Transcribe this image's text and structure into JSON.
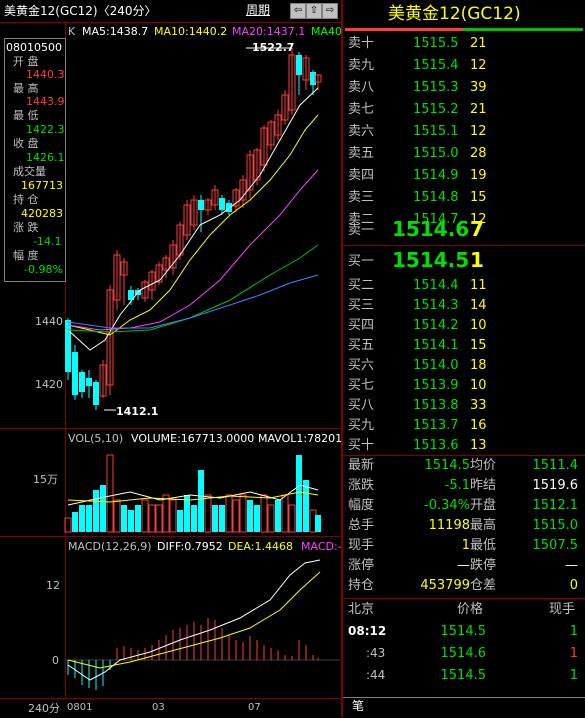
{
  "window": {
    "title": "美黄金12(GC12)〈240分〉",
    "period_button": "周期",
    "nav_buttons": [
      "⇦",
      "⇧",
      "⇨",
      "⇩"
    ]
  },
  "info_panel": {
    "time": "08010500",
    "open_label": "开 盘",
    "open": "1440.3",
    "high_label": "最 高",
    "high": "1443.9",
    "low_label": "最 低",
    "low": "1422.3",
    "close_label": "收 盘",
    "close": "1426.1",
    "volume_label": "成交量",
    "volume": "167713",
    "oi_label": "持 仓",
    "oi": "420283",
    "change_label": "涨 跌",
    "change": "-14.1",
    "pct_label": "幅 度",
    "pct": "-0.98%"
  },
  "main_chart": {
    "k_label": "K",
    "ma5": "MA5:1438.7",
    "ma10": "MA10:1440.2",
    "ma20": "MA20:1437.1",
    "ma40": "MA40",
    "high_annotation": "1522.7",
    "low_annotation": "1412.1",
    "y_ticks": [
      "1440",
      "1420"
    ]
  },
  "volume_chart": {
    "label": "VOL(5,10)",
    "volume": "VOLUME:167713.0000",
    "mavol": "MAVOL1:78201",
    "y_tick": "15万"
  },
  "macd_chart": {
    "label": "MACD(12,26,9)",
    "diff": "DIFF:0.7952",
    "dea": "DEA:1.4468",
    "macd": "MACD:-",
    "y_ticks": [
      "12",
      "0"
    ]
  },
  "bottom_bar": {
    "period": "240分",
    "x_ticks": [
      "0801",
      "03",
      "07"
    ]
  },
  "quote": {
    "title": "美黄金12(GC12)",
    "colors": {
      "up": "#ff3c3c",
      "down": "#00e000",
      "neutral": "#ffff00"
    },
    "sells": [
      {
        "label": "卖十",
        "price": "1515.5",
        "qty": "21"
      },
      {
        "label": "卖九",
        "price": "1515.4",
        "qty": "12"
      },
      {
        "label": "卖八",
        "price": "1515.3",
        "qty": "39"
      },
      {
        "label": "卖七",
        "price": "1515.2",
        "qty": "21"
      },
      {
        "label": "卖六",
        "price": "1515.1",
        "qty": "12"
      },
      {
        "label": "卖五",
        "price": "1515.0",
        "qty": "28"
      },
      {
        "label": "卖四",
        "price": "1514.9",
        "qty": "19"
      },
      {
        "label": "卖三",
        "price": "1514.8",
        "qty": "15"
      },
      {
        "label": "卖二",
        "price": "1514.7",
        "qty": "12"
      }
    ],
    "sell1": {
      "label": "卖一",
      "price": "1514.6",
      "qty": "7"
    },
    "buy1": {
      "label": "买一",
      "price": "1514.5",
      "qty": "1"
    },
    "buys": [
      {
        "label": "买二",
        "price": "1514.4",
        "qty": "11"
      },
      {
        "label": "买三",
        "price": "1514.3",
        "qty": "14"
      },
      {
        "label": "买四",
        "price": "1514.2",
        "qty": "10"
      },
      {
        "label": "买五",
        "price": "1514.1",
        "qty": "15"
      },
      {
        "label": "买六",
        "price": "1514.0",
        "qty": "18"
      },
      {
        "label": "买七",
        "price": "1513.9",
        "qty": "10"
      },
      {
        "label": "买八",
        "price": "1513.8",
        "qty": "33"
      },
      {
        "label": "买九",
        "price": "1513.7",
        "qty": "16"
      },
      {
        "label": "买十",
        "price": "1513.6",
        "qty": "13"
      }
    ],
    "stats": [
      {
        "l1": "最新",
        "v1": "1514.5",
        "c1": "green",
        "l2": "均价",
        "v2": "1511.4",
        "c2": "green"
      },
      {
        "l1": "涨跌",
        "v1": "-5.1",
        "c1": "green",
        "l2": "昨结",
        "v2": "1519.6",
        "c2": "white"
      },
      {
        "l1": "幅度",
        "v1": "-0.34%",
        "c1": "green",
        "l2": "开盘",
        "v2": "1512.1",
        "c2": "green"
      },
      {
        "l1": "总手",
        "v1": "11198",
        "c1": "yellow",
        "l2": "最高",
        "v2": "1515.0",
        "c2": "green"
      },
      {
        "l1": "现手",
        "v1": "1",
        "c1": "yellow",
        "l2": "最低",
        "v2": "1507.5",
        "c2": "green"
      },
      {
        "l1": "涨停",
        "v1": "—",
        "c1": "white",
        "l2": "跌停",
        "v2": "—",
        "c2": "white"
      },
      {
        "l1": "持仓",
        "v1": "453799",
        "c1": "yellow",
        "l2": "仓差",
        "v2": "0",
        "c2": "yellow"
      }
    ],
    "ticks_header": {
      "col1": "北京",
      "col2": "价格",
      "col3": "现手"
    },
    "ticks": [
      {
        "time": "08:12",
        "price": "1514.5",
        "qty": "1",
        "qcolor": "green"
      },
      {
        "time": ":43",
        "price": "1514.6",
        "qty": "1",
        "qcolor": "red"
      },
      {
        "time": ":44",
        "price": "1514.5",
        "qty": "1",
        "qcolor": "green"
      }
    ],
    "bottom_tab": "笔"
  }
}
